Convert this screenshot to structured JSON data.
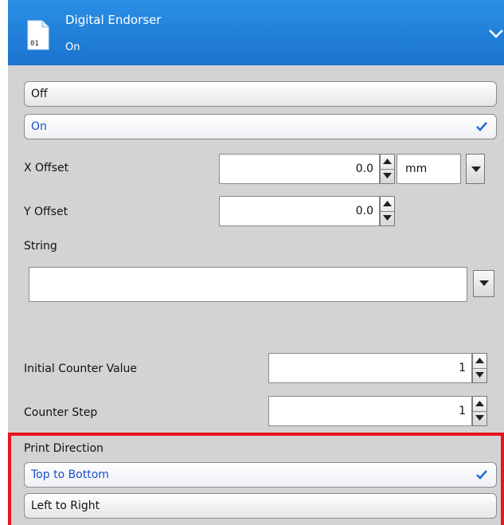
{
  "header": {
    "title": "Digital Endorser",
    "subtitle": "On",
    "icon_text": "01"
  },
  "endorser_options": {
    "off_label": "Off",
    "on_label": "On",
    "selected": "On"
  },
  "x_offset": {
    "label": "X Offset",
    "value": "0.0",
    "unit": "mm"
  },
  "y_offset": {
    "label": "Y Offset",
    "value": "0.0"
  },
  "string": {
    "label": "String",
    "value": ""
  },
  "initial_counter": {
    "label": "Initial Counter Value",
    "value": "1"
  },
  "counter_step": {
    "label": "Counter Step",
    "value": "1"
  },
  "print_direction": {
    "label": "Print Direction",
    "option_1": "Top to Bottom",
    "option_2": "Left to Right",
    "selected": "Top to Bottom"
  },
  "colors": {
    "header_blue": "#1a73cf",
    "panel_gray": "#d3d3d3",
    "selected_text": "#1a4fc4",
    "check_blue": "#1f6fd6",
    "highlight_red": "#e8141e"
  }
}
